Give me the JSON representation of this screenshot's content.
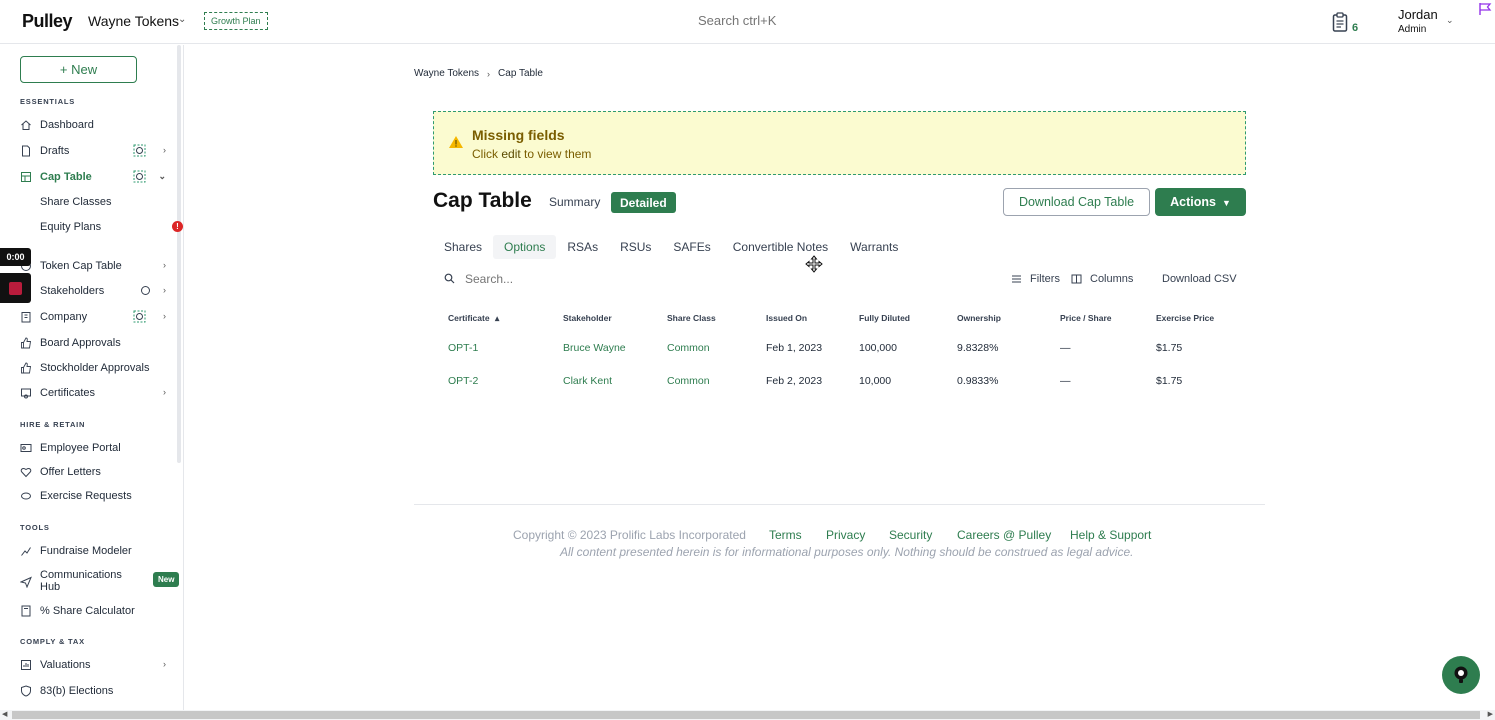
{
  "topbar": {
    "logo": "Pulley",
    "company": "Wayne Tokens",
    "plan": "Growth Plan",
    "search_placeholder": "Search ctrl+K",
    "notification_count": "6",
    "user_name": "Jordan",
    "user_role": "Admin"
  },
  "sidebar": {
    "new_label": "+ New",
    "sections": {
      "essentials": "ESSENTIALS",
      "hire": "HIRE & RETAIN",
      "tools": "TOOLS",
      "comply": "COMPLY & TAX"
    },
    "items": {
      "dashboard": "Dashboard",
      "drafts": "Drafts",
      "cap_table": "Cap Table",
      "share_classes": "Share Classes",
      "equity_plans": "Equity Plans",
      "token_cap_table": "Token Cap Table",
      "stakeholders": "Stakeholders",
      "company": "Company",
      "board_approvals": "Board Approvals",
      "stockholder_approvals": "Stockholder Approvals",
      "certificates": "Certificates",
      "employee_portal": "Employee Portal",
      "offer_letters": "Offer Letters",
      "exercise_requests": "Exercise Requests",
      "fundraise_modeler": "Fundraise Modeler",
      "communications_hub_1": "Communications",
      "communications_hub_2": "Hub",
      "share_calculator": "% Share Calculator",
      "valuations": "Valuations",
      "elections": "83(b) Elections"
    },
    "equity_plans_alert": "!",
    "new_tag": "New",
    "timer": "0:00"
  },
  "breadcrumb": [
    "Wayne Tokens",
    "Cap Table"
  ],
  "alert": {
    "title": "Missing fields",
    "body_prefix": "Click",
    "body_link": "edit",
    "body_suffix": "to view them"
  },
  "main": {
    "title": "Cap Table",
    "view_summary": "Summary",
    "view_detailed": "Detailed",
    "download_cap_table": "Download Cap Table",
    "actions": "Actions",
    "tabs": [
      "Shares",
      "Options",
      "RSAs",
      "RSUs",
      "SAFEs",
      "Convertible Notes",
      "Warrants"
    ],
    "active_tab": "Options",
    "search_placeholder": "Search...",
    "filters": "Filters",
    "columns": "Columns",
    "download_csv": "Download CSV"
  },
  "table": {
    "headers": [
      "Certificate",
      "Stakeholder",
      "Share Class",
      "Issued On",
      "Fully Diluted",
      "Ownership",
      "Price / Share",
      "Exercise Price"
    ],
    "sort_indicator": "▴",
    "rows": [
      [
        "OPT-1",
        "Bruce Wayne",
        "Common",
        "Feb 1, 2023",
        "100,000",
        "9.8328%",
        "—",
        "$1.75"
      ],
      [
        "OPT-2",
        "Clark Kent",
        "Common",
        "Feb 2, 2023",
        "10,000",
        "0.9833%",
        "—",
        "$1.75"
      ]
    ]
  },
  "footer": {
    "copyright": "Copyright © 2023 Prolific Labs Incorporated",
    "links": [
      "Terms",
      "Privacy",
      "Security",
      "Careers @ Pulley",
      "Help & Support"
    ],
    "disclaimer": "All content presented herein is for informational purposes only. Nothing should be construed as legal advice."
  },
  "colors": {
    "brand_green": "#2e7d4f",
    "alert_bg": "#fbfbd0",
    "error_red": "#dc2626"
  },
  "icons": [
    "home-icon",
    "file-icon",
    "table-icon",
    "coins-icon",
    "users-icon",
    "building-icon",
    "thumbs-up-icon",
    "certificate-icon",
    "id-card-icon",
    "heart-icon",
    "refresh-icon",
    "trend-icon",
    "send-icon",
    "calculator-icon",
    "chart-icon",
    "shield-icon",
    "warning-icon",
    "search-icon",
    "filter-icon",
    "columns-icon",
    "clipboard-icon",
    "flag-icon",
    "move-cursor-icon",
    "help-icon"
  ]
}
